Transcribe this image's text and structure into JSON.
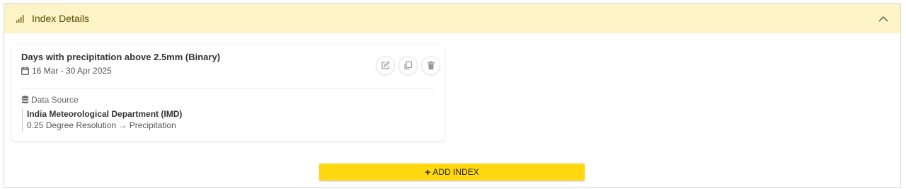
{
  "section": {
    "title": "Index Details",
    "icon": "bar-chart-icon",
    "collapse_icon": "chevron-up-icon"
  },
  "index_card": {
    "title": "Days with precipitation above 2.5mm (Binary)",
    "date_range": "16 Mar - 30 Apr 2025",
    "actions": [
      "edit-icon",
      "copy-icon",
      "delete-icon"
    ],
    "data_source_label": "Data Source",
    "data_source_name": "India Meteorological Department (IMD)",
    "data_source_detail": "0.25 Degree Resolution → Precipitation"
  },
  "add_button": {
    "plus": "+",
    "label": "ADD INDEX"
  },
  "colors": {
    "header_bg": "#fcf3c6",
    "accent": "#ffd80f"
  }
}
